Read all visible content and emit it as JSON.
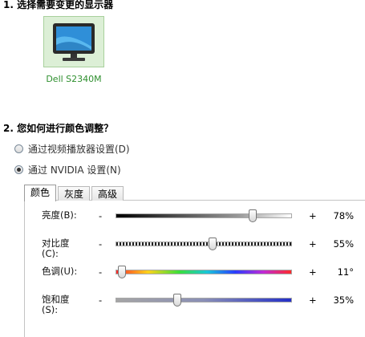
{
  "step1": {
    "title": "1. 选择需要变更的显示器"
  },
  "monitor": {
    "name": "Dell S2340M",
    "icon": "monitor-icon"
  },
  "step2": {
    "title": "2. 您如何进行颜色调整？"
  },
  "options": [
    {
      "label": "通过视频播放器设置(D)",
      "selected": false
    },
    {
      "label": "通过 NVIDIA 设置(N)",
      "selected": true
    }
  ],
  "tabs": [
    "颜色",
    "灰度",
    "高级"
  ],
  "active_tab": "颜色",
  "sliders": [
    {
      "label": "亮度(B):",
      "minus": "-",
      "plus": "+",
      "value": "78%",
      "level": 0.78
    },
    {
      "label": "对比度\n(C):",
      "minus": "-",
      "plus": "+",
      "value": "55%",
      "level": 0.55
    },
    {
      "label": "色调(U):",
      "minus": "-",
      "plus": "+",
      "value": "11°",
      "level": 0.03
    },
    {
      "label": "饱和度\n(S):",
      "minus": "-",
      "plus": "+",
      "value": "35%",
      "level": 0.35
    }
  ],
  "colors": {
    "monitor_name": "#2e8f2e",
    "tile_bg": "#dcefd6"
  }
}
